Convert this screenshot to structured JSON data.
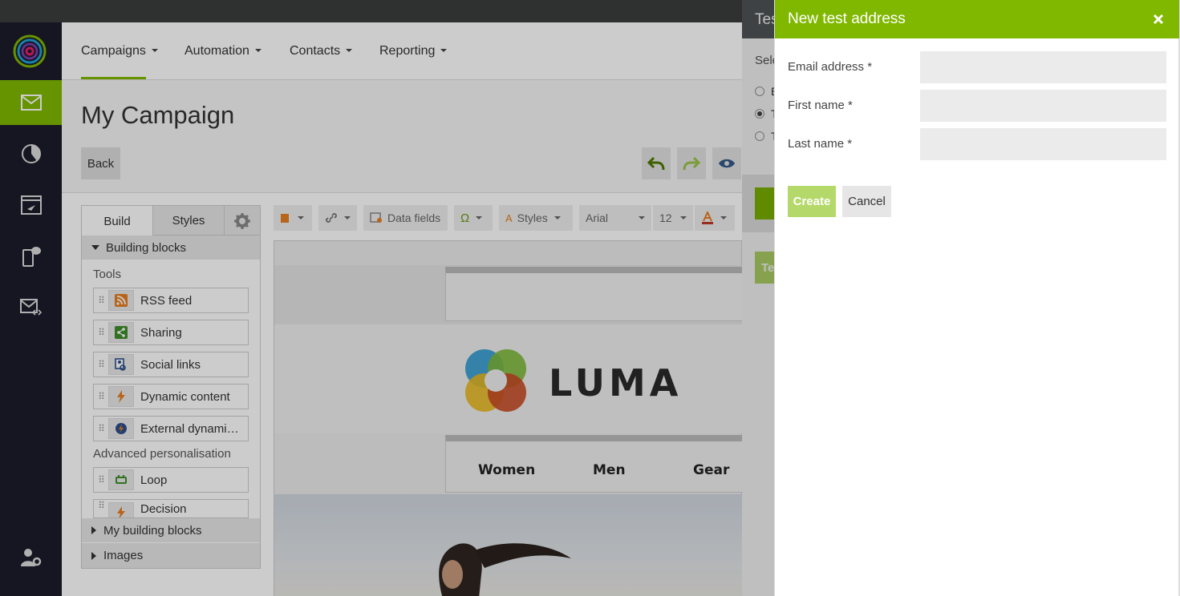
{
  "app": {
    "nav_icons": [
      "logo-icon",
      "envelope-icon",
      "pie-chart-icon",
      "automation-icon",
      "mobile-icon",
      "mail-code-icon",
      "user-settings-icon"
    ]
  },
  "menu": {
    "items": [
      {
        "label": "Campaigns"
      },
      {
        "label": "Automation"
      },
      {
        "label": "Contacts"
      },
      {
        "label": "Reporting"
      }
    ]
  },
  "page": {
    "title": "My Campaign",
    "back_label": "Back"
  },
  "panel": {
    "tabs": [
      {
        "label": "Build"
      },
      {
        "label": "Styles"
      }
    ],
    "section_building_blocks": "Building blocks",
    "group_tools": "Tools",
    "tools": [
      {
        "label": "RSS feed",
        "icon": "rss-icon"
      },
      {
        "label": "Sharing",
        "icon": "share-icon"
      },
      {
        "label": "Social links",
        "icon": "social-links-icon"
      },
      {
        "label": "Dynamic content",
        "icon": "lightning-icon"
      },
      {
        "label": "External dynamic content",
        "icon": "external-dynamic-icon"
      }
    ],
    "group_advanced": "Advanced personalisation",
    "advanced": [
      {
        "label": "Loop",
        "icon": "loop-icon"
      },
      {
        "label": "Decision",
        "icon": "lightning-icon"
      }
    ],
    "section_my_blocks": "My building blocks",
    "section_images": "Images"
  },
  "format_bar": {
    "data_fields": "Data fields",
    "styles": "Styles",
    "font": "Arial",
    "size": "12"
  },
  "canvas": {
    "brand": "LUMA",
    "categories": [
      "Women",
      "Men",
      "Gear"
    ]
  },
  "behind_dialog": {
    "title": "Tes",
    "subtitle": "Sele",
    "options": [
      "E",
      "T",
      "T"
    ],
    "button_fragment": "Te"
  },
  "drawer": {
    "title": "New test address",
    "fields": [
      {
        "label": "Email address *",
        "value": ""
      },
      {
        "label": "First name *",
        "value": ""
      },
      {
        "label": "Last name *",
        "value": ""
      }
    ],
    "create_label": "Create",
    "cancel_label": "Cancel"
  },
  "colors": {
    "accent": "#80b800",
    "nav_bg": "#1c1b2b",
    "create_disabled": "#b5d86a"
  }
}
